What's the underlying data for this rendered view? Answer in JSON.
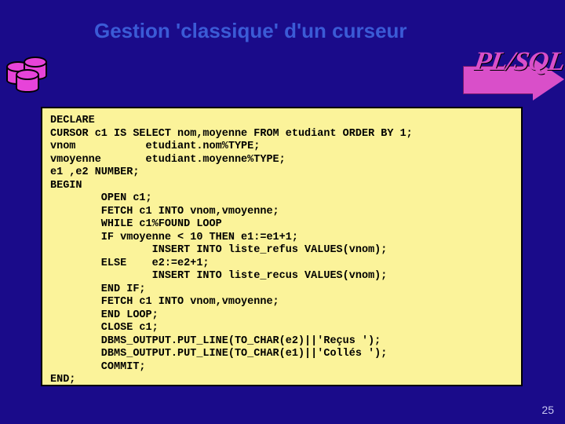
{
  "title": "Gestion 'classique' d'un curseur",
  "arrow_label": "PL/SQL",
  "page_number": "25",
  "code": "DECLARE\nCURSOR c1 IS SELECT nom,moyenne FROM etudiant ORDER BY 1;\nvnom           etudiant.nom%TYPE;\nvmoyenne       etudiant.moyenne%TYPE;\ne1 ,e2 NUMBER;\nBEGIN\n        OPEN c1;\n        FETCH c1 INTO vnom,vmoyenne;\n        WHILE c1%FOUND LOOP\n        IF vmoyenne < 10 THEN e1:=e1+1;\n                INSERT INTO liste_refus VALUES(vnom);\n        ELSE    e2:=e2+1;\n                INSERT INTO liste_recus VALUES(vnom);\n        END IF;\n        FETCH c1 INTO vnom,vmoyenne;\n        END LOOP;\n        CLOSE c1;\n        DBMS_OUTPUT.PUT_LINE(TO_CHAR(e2)||'Reçus ');\n        DBMS_OUTPUT.PUT_LINE(TO_CHAR(e1)||'Collés ');\n        COMMIT;\nEND;"
}
